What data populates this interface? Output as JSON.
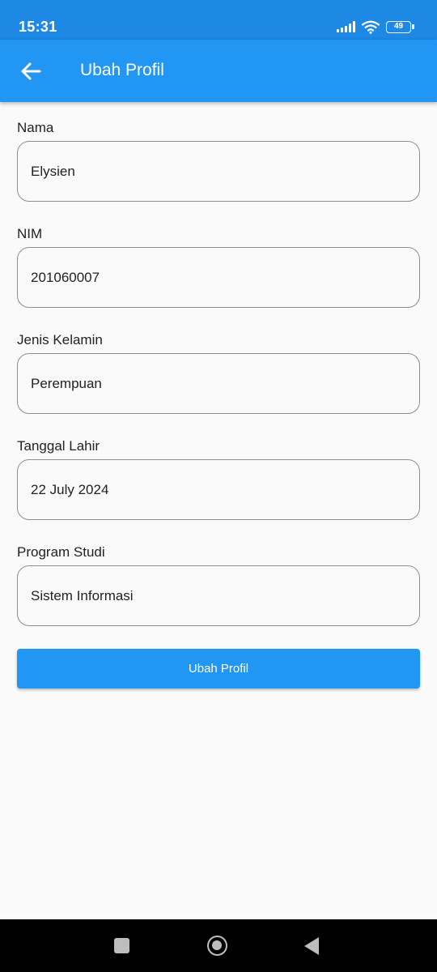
{
  "status_bar": {
    "time": "15:31",
    "battery_level": "49",
    "icons": [
      "signal-icon",
      "wifi-icon",
      "battery-icon"
    ]
  },
  "app_bar": {
    "title": "Ubah Profil",
    "back_icon": "arrow-back-icon"
  },
  "form": {
    "fields": [
      {
        "label": "Nama",
        "value": "Elysien"
      },
      {
        "label": "NIM",
        "value": "201060007"
      },
      {
        "label": "Jenis Kelamin",
        "value": "Perempuan"
      },
      {
        "label": "Tanggal Lahir",
        "value": "22 July 2024"
      },
      {
        "label": "Program Studi",
        "value": "Sistem Informasi"
      }
    ],
    "submit_label": "Ubah Profil"
  },
  "nav_bar": {
    "icons": [
      "recent-apps-icon",
      "home-icon",
      "back-icon"
    ]
  },
  "colors": {
    "status_bar": "#1e88e5",
    "app_bar": "#2196f3",
    "button": "#2196f3",
    "background": "#fafafa"
  }
}
